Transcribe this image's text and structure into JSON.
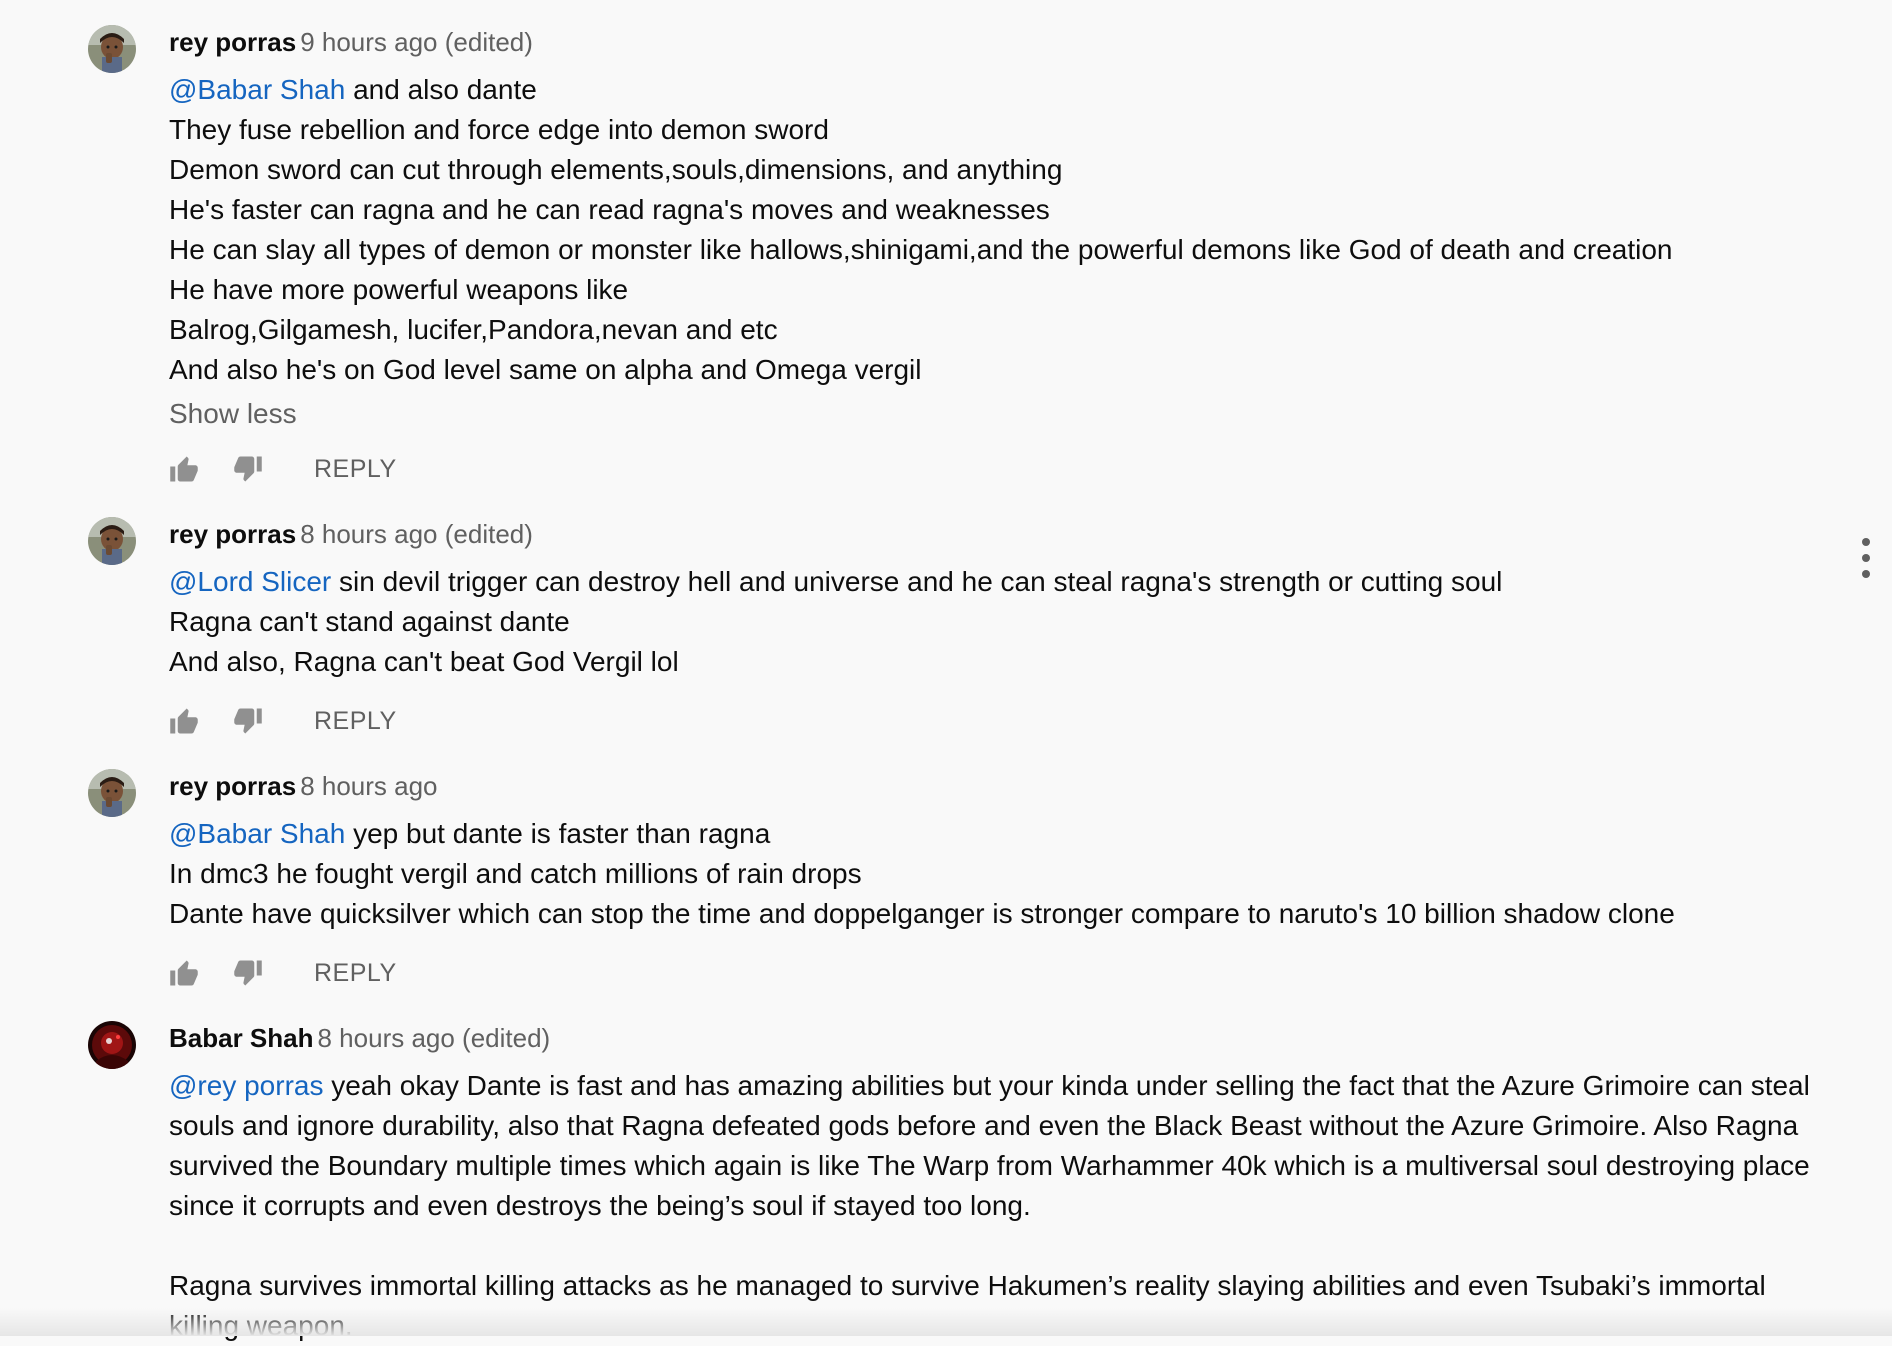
{
  "comments": [
    {
      "author": "rey porras",
      "meta": "9 hours ago (edited)",
      "mention": "@Babar Shah",
      "first_line_rest": " and also dante",
      "lines": [
        "They fuse rebellion and force edge into demon sword",
        "Demon sword can cut through elements,souls,dimensions, and anything",
        "He's faster can ragna and he can read ragna's moves and weaknesses",
        "He can slay all types of demon or monster like hallows,shinigami,and the powerful demons like God of death and creation",
        "He have more powerful weapons like",
        "Balrog,Gilgamesh, lucifer,Pandora,nevan and etc",
        "And also he's on God level same on alpha and Omega vergil"
      ],
      "show_less": "Show less",
      "reply": "REPLY",
      "avatar_icon": "user-photo-avatar"
    },
    {
      "author": "rey porras",
      "meta": "8 hours ago (edited)",
      "mention": "@Lord Slicer",
      "first_line_rest": " sin devil trigger can destroy hell and universe and he can steal ragna's strength or cutting soul",
      "lines": [
        "Ragna can't stand against dante",
        "And also, Ragna can't beat God Vergil lol"
      ],
      "reply": "REPLY",
      "avatar_icon": "user-photo-avatar"
    },
    {
      "author": "rey porras",
      "meta": "8 hours ago",
      "mention": "@Babar Shah",
      "first_line_rest": " yep but dante is faster than ragna",
      "lines": [
        "In dmc3 he fought vergil and catch millions of rain drops",
        "Dante have quicksilver which can stop the time and doppelganger is stronger compare to naruto's 10 billion shadow clone"
      ],
      "reply": "REPLY",
      "avatar_icon": "user-photo-avatar"
    },
    {
      "author": "Babar Shah",
      "meta": "8 hours ago (edited)",
      "mention": "@rey porras",
      "first_line_rest": " yeah okay Dante is fast and has amazing abilities but your kinda under selling the fact that the Azure Grimoire can steal",
      "lines": [
        "souls and ignore durability, also that Ragna defeated gods before and even the Black Beast without the Azure Grimoire. Also Ragna",
        "survived the Boundary multiple times which again is like The Warp from Warhammer 40k which is a multiversal soul destroying place",
        "since it corrupts and even destroys the being’s soul if stayed too long.",
        "",
        "Ragna survives immortal killing attacks as he managed to survive Hakumen’s reality slaying abilities and even Tsubaki’s immortal",
        "killing weapon."
      ],
      "avatar_icon": "red-character-avatar"
    }
  ],
  "icons": {
    "like": "thumbs-up-icon",
    "dislike": "thumbs-down-icon",
    "more": "more-vertical-icon"
  },
  "colors": {
    "background": "#f9f9f9",
    "mention": "#1565c0",
    "meta": "#606060",
    "text": "#0d0d0d"
  }
}
